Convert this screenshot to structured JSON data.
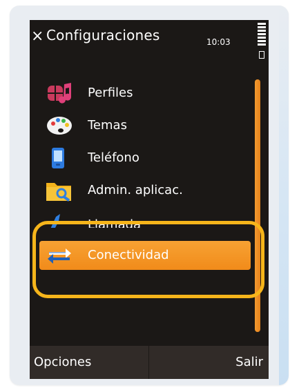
{
  "header": {
    "title": "Configuraciones",
    "time": "10:03",
    "close_icon": "close-icon"
  },
  "menu": {
    "items": [
      {
        "label": "Perfiles",
        "icon": "profiles-icon"
      },
      {
        "label": "Temas",
        "icon": "themes-palette-icon"
      },
      {
        "label": "Teléfono",
        "icon": "phone-icon"
      },
      {
        "label": "Admin. aplicac.",
        "icon": "app-manager-folder-icon"
      },
      {
        "label": "Llamada",
        "icon": "call-handset-icon"
      },
      {
        "label": "Conectividad",
        "icon": "connectivity-arrows-icon",
        "selected": true
      }
    ]
  },
  "softkeys": {
    "left": "Opciones",
    "right": "Salir"
  },
  "colors": {
    "screen_bg": "#1b1816",
    "accent_orange": "#f18b1a",
    "highlight_ring": "#f6b51b",
    "softkey_bg": "#312b28"
  }
}
